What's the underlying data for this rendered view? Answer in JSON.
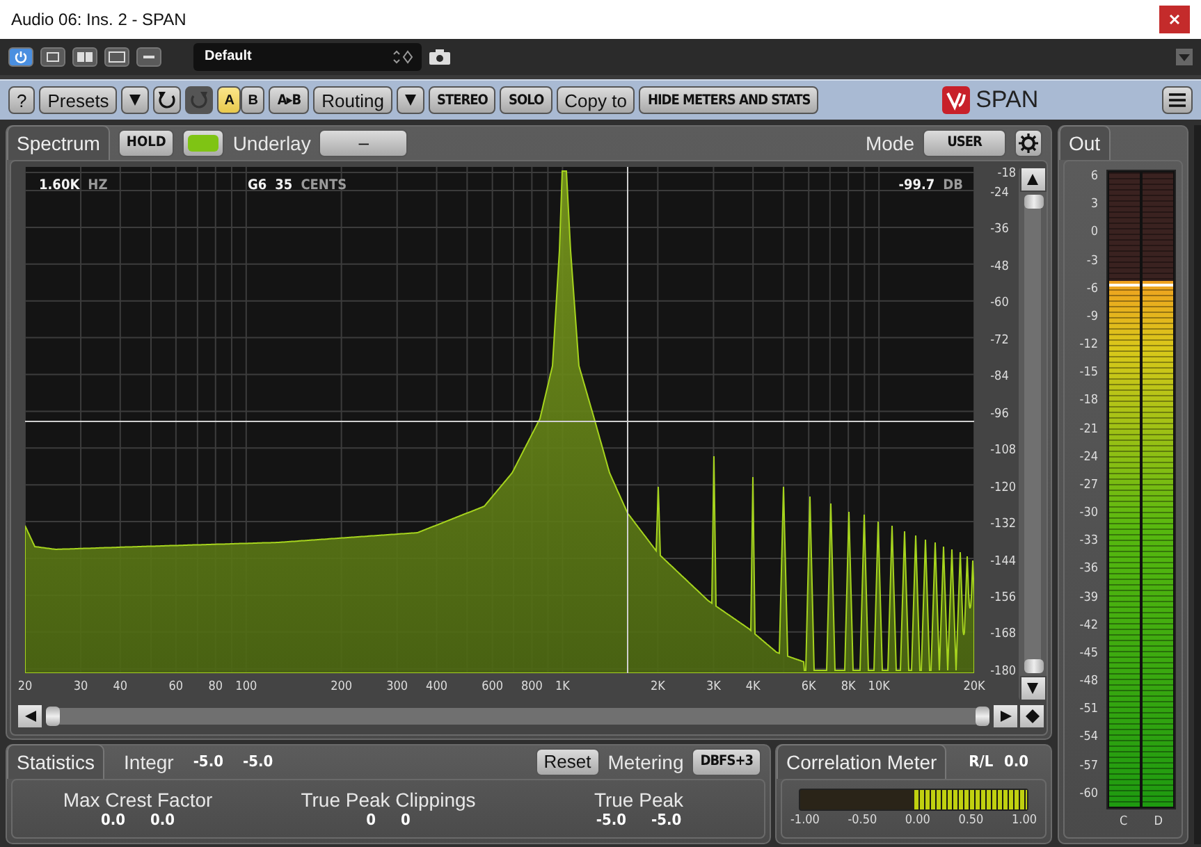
{
  "window": {
    "title": "Audio 06: Ins. 2 - SPAN"
  },
  "host_toolbar": {
    "power": {
      "on": true
    },
    "preset": "Default"
  },
  "plugin_toolbar": {
    "help": "?",
    "presets": "Presets",
    "undo": {
      "disabled": false
    },
    "redo": {
      "disabled": true
    },
    "ab": [
      {
        "label": "A",
        "selected": true
      },
      {
        "label": "B",
        "selected": false
      }
    ],
    "ab_copy": "A▸B",
    "routing": "Routing",
    "stereo": "STEREO",
    "solo": "SOLO",
    "copy_to": "Copy to",
    "hide": "HIDE METERS AND STATS",
    "brand": "SPAN"
  },
  "spectrum": {
    "tab": "Spectrum",
    "hold": {
      "label": "HOLD",
      "on": false
    },
    "color_toggle": {
      "on": true
    },
    "underlay_label": "Underlay",
    "underlay_value": "–",
    "mode_label": "Mode",
    "mode_value": "USER",
    "readouts": [
      {
        "value": "1.60K",
        "unit": "HZ"
      }
    ],
    "pitch": {
      "note": "G6",
      "cents": "35",
      "unit": "CENTS"
    },
    "db_readout": {
      "value": "-99.7",
      "unit": "DB"
    },
    "db_scale": [
      "-18",
      "-24",
      "-36",
      "-48",
      "-60",
      "-72",
      "-84",
      "-96",
      "-108",
      "-120",
      "-132",
      "-144",
      "-156",
      "-168",
      "-180"
    ],
    "freq_scale": [
      "20",
      "30",
      "40",
      "60",
      "80",
      "100",
      "200",
      "300",
      "400",
      "600",
      "800",
      "1K",
      "2K",
      "3K",
      "4K",
      "6K",
      "8K",
      "10K",
      "20K"
    ]
  },
  "out": {
    "tab": "Out",
    "scale": [
      "6",
      "3",
      "0",
      "-3",
      "-6",
      "-9",
      "-12",
      "-15",
      "-18",
      "-21",
      "-24",
      "-27",
      "-30",
      "-33",
      "-36",
      "-39",
      "-42",
      "-45",
      "-48",
      "-51",
      "-54",
      "-57",
      "-60"
    ],
    "channels": [
      {
        "label": "C",
        "level": 0.83
      },
      {
        "label": "D",
        "level": 0.83
      }
    ]
  },
  "statistics": {
    "tab": "Statistics",
    "integr_label": "Integr",
    "integr_values": [
      "-5.0",
      "-5.0"
    ],
    "reset": "Reset",
    "metering_label": "Metering",
    "metering_value": "DBFS+3",
    "groups": [
      {
        "label": "Max Crest Factor",
        "values": [
          "0.0",
          "0.0"
        ]
      },
      {
        "label": "True Peak Clippings",
        "values": [
          "0",
          "0"
        ]
      },
      {
        "label": "True Peak",
        "values": [
          "-5.0",
          "-5.0"
        ]
      }
    ]
  },
  "correlation": {
    "tab": "Correlation Meter",
    "channel_label": "R/L",
    "value": "0.0",
    "level": 0.5,
    "scale": [
      "-1.00",
      "-0.50",
      "0.00",
      "0.50",
      "1.00"
    ]
  }
}
